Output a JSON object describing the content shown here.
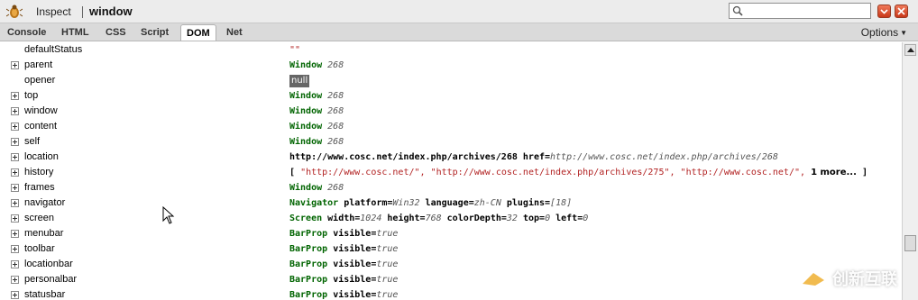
{
  "toolbar": {
    "inspect_label": "Inspect",
    "breadcrumb": "window",
    "search_value": ""
  },
  "tabs": [
    "Console",
    "HTML",
    "CSS",
    "Script",
    "DOM",
    "Net"
  ],
  "active_tab": "DOM",
  "options_label": "Options",
  "dom_rows": [
    {
      "name": "defaultStatus",
      "expandable": false,
      "value_string": "\"\""
    },
    {
      "name": "parent",
      "expandable": true,
      "value_obj": "Window",
      "value_num": "268"
    },
    {
      "name": "opener",
      "expandable": false,
      "value_null": "null"
    },
    {
      "name": "top",
      "expandable": true,
      "value_obj": "Window",
      "value_num": "268"
    },
    {
      "name": "window",
      "expandable": true,
      "value_obj": "Window",
      "value_num": "268"
    },
    {
      "name": "content",
      "expandable": true,
      "value_obj": "Window",
      "value_num": "268"
    },
    {
      "name": "self",
      "expandable": true,
      "value_obj": "Window",
      "value_num": "268"
    },
    {
      "name": "location",
      "expandable": true,
      "value_url": "http://www.cosc.net/index.php/archives/268",
      "value_attr": "href=",
      "value_attr_val": "http://www.cosc.net/index.php/archives/268"
    },
    {
      "name": "history",
      "expandable": true,
      "history_open": "[",
      "history_items": [
        "\"http://www.cosc.net/\",",
        "\"http://www.cosc.net/index.php/archives/275\",",
        "\"http://www.cosc.net/\","
      ],
      "history_more": "1 more...",
      "history_close": "]"
    },
    {
      "name": "frames",
      "expandable": true,
      "value_obj": "Window",
      "value_num": "268"
    },
    {
      "name": "navigator",
      "expandable": true,
      "value_obj": "Navigator",
      "attrs": [
        [
          "platform=",
          "Win32"
        ],
        [
          "language=",
          "zh-CN"
        ],
        [
          "plugins=",
          "[18]"
        ]
      ]
    },
    {
      "name": "screen",
      "expandable": true,
      "value_obj": "Screen",
      "attrs": [
        [
          "width=",
          "1024"
        ],
        [
          "height=",
          "768"
        ],
        [
          "colorDepth=",
          "32"
        ],
        [
          "top=",
          "0"
        ],
        [
          "left=",
          "0"
        ]
      ]
    },
    {
      "name": "menubar",
      "expandable": true,
      "value_obj": "BarProp",
      "attrs": [
        [
          "visible=",
          "true"
        ]
      ]
    },
    {
      "name": "toolbar",
      "expandable": true,
      "value_obj": "BarProp",
      "attrs": [
        [
          "visible=",
          "true"
        ]
      ]
    },
    {
      "name": "locationbar",
      "expandable": true,
      "value_obj": "BarProp",
      "attrs": [
        [
          "visible=",
          "true"
        ]
      ]
    },
    {
      "name": "personalbar",
      "expandable": true,
      "value_obj": "BarProp",
      "attrs": [
        [
          "visible=",
          "true"
        ]
      ]
    },
    {
      "name": "statusbar",
      "expandable": true,
      "value_obj": "BarProp",
      "attrs": [
        [
          "visible=",
          "true"
        ]
      ]
    }
  ],
  "watermark": {
    "text": "创新互联"
  },
  "icons": {
    "app": "firebug-icon",
    "search": "search-icon",
    "minimize": "minimize-icon",
    "close": "close-icon",
    "expand": "expand-icon",
    "cursor": "mouse-cursor-icon"
  },
  "colors": {
    "object": "#006400",
    "string": "#b22222",
    "button": "#d9482a"
  }
}
